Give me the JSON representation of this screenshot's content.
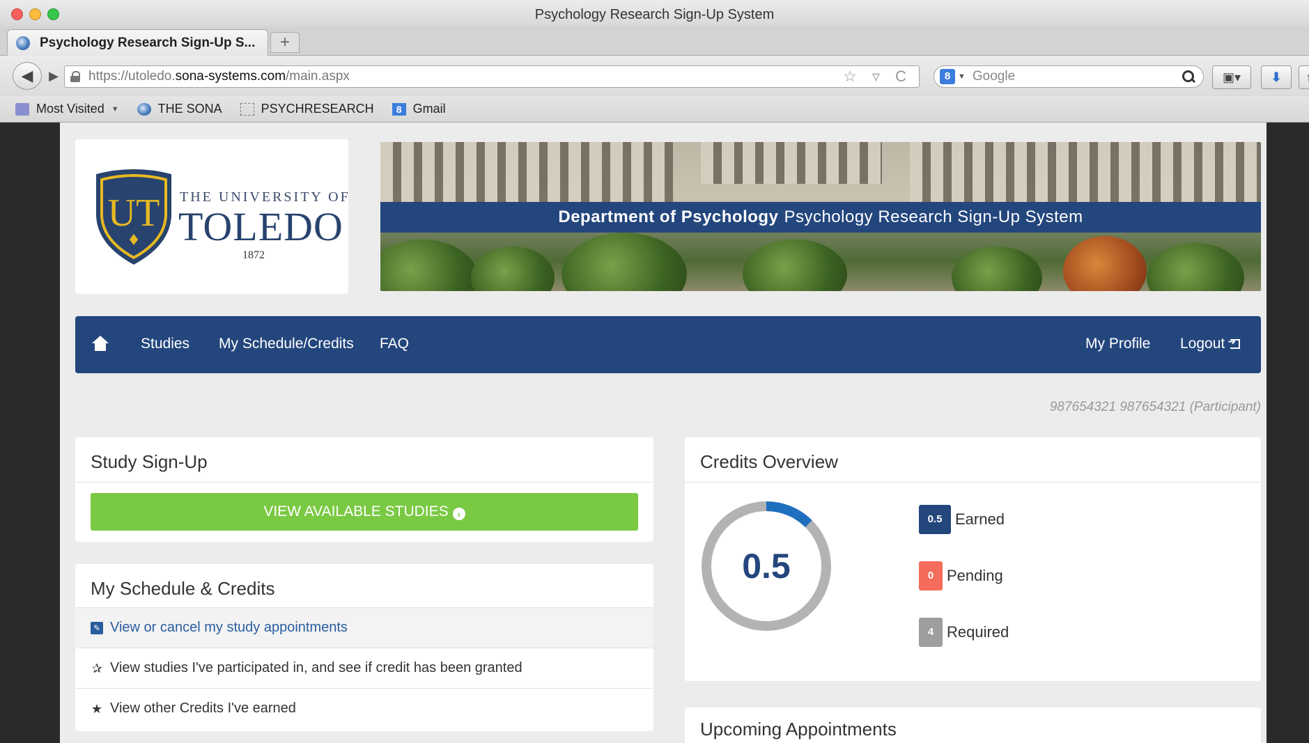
{
  "browser": {
    "window_title": "Psychology Research Sign-Up System",
    "tab_label": "Psychology Research Sign-Up S...",
    "new_tab_symbol": "+",
    "back_symbol": "◀",
    "forward_symbol": "▶",
    "url_prefix": "https://utoledo.",
    "url_domain": "sona-systems.com",
    "url_path": "/main.aspx",
    "url_icons": "☆ ▿ C",
    "search_engine_letter": "8",
    "search_placeholder": "Google",
    "bookmarks_btn": "▣▾",
    "download_btn": "⬇",
    "more_btn": "↑",
    "bookmarks": [
      {
        "label": "Most Visited",
        "icon": "folder-icon"
      },
      {
        "label": "THE SONA",
        "icon": "sona-icon"
      },
      {
        "label": "PSYCHRESEARCH",
        "icon": "page-icon"
      },
      {
        "label": "Gmail",
        "icon": "google-icon",
        "glyph": "8"
      }
    ]
  },
  "logo": {
    "top": "THE UNIVERSITY OF",
    "main": "TOLEDO",
    "year": "1872",
    "shield_letters": "UT",
    "shield_color": "#27436e",
    "shield_gold": "#e8b923"
  },
  "banner": {
    "bold": "Department of Psychology",
    "text": "Psychology Research Sign-Up System"
  },
  "nav": {
    "studies": "Studies",
    "schedule": "My Schedule/Credits",
    "faq": "FAQ",
    "profile": "My Profile",
    "logout": "Logout"
  },
  "user_line": "987654321 987654321 (Participant)",
  "signup": {
    "title": "Study Sign-Up",
    "button": "VIEW AVAILABLE STUDIES",
    "button_icon": "›"
  },
  "schedule": {
    "title": "My Schedule & Credits",
    "items": [
      {
        "label": "View or cancel my study appointments",
        "icon": "edit-icon",
        "glyph": "✎"
      },
      {
        "label": "View studies I've participated in, and see if credit has been granted",
        "icon": "star-half-icon",
        "glyph": "✰"
      },
      {
        "label": "View other Credits I've earned",
        "icon": "star-icon",
        "glyph": "★"
      }
    ]
  },
  "credits": {
    "title": "Credits Overview",
    "value": "0.5",
    "earned": 0.5,
    "required": 4,
    "ring_color": "#b3b3b3",
    "earned_color": "#1f6fbf",
    "legend": [
      {
        "badge": "0.5",
        "label": "Earned",
        "color": "#23467d"
      },
      {
        "badge": "0",
        "label": "Pending",
        "color": "#f56c5c"
      },
      {
        "badge": "4",
        "label": "Required",
        "color": "#9e9e9e"
      }
    ]
  },
  "appointments": {
    "title": "Upcoming Appointments"
  }
}
